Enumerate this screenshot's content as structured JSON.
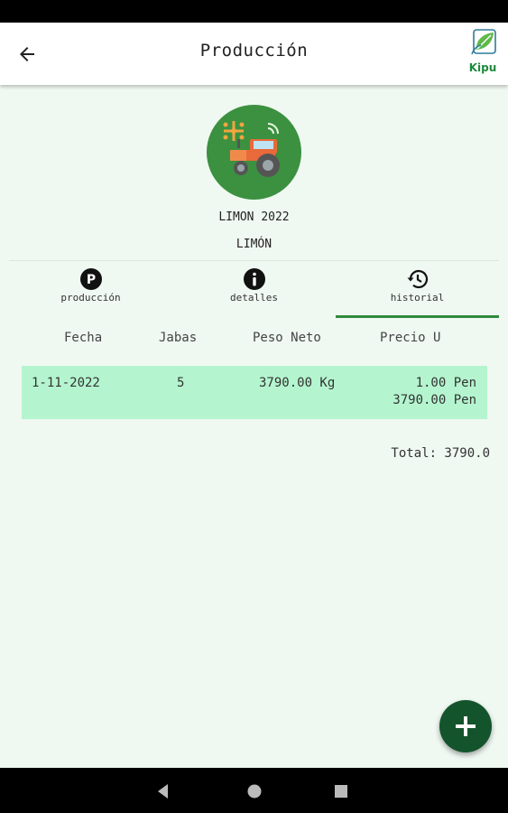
{
  "header": {
    "title": "Producción",
    "logo_text": "Kipu"
  },
  "crop": {
    "name": "LIMON 2022",
    "type": "LIMÓN"
  },
  "tabs": [
    {
      "label": "producción",
      "icon": "p-circle-icon"
    },
    {
      "label": "detalles",
      "icon": "info-circle-icon"
    },
    {
      "label": "historial",
      "icon": "history-icon",
      "selected": true
    }
  ],
  "table": {
    "headers": [
      "Fecha",
      "Jabas",
      "Peso Neto",
      "Precio U"
    ],
    "rows": [
      {
        "fecha": "1-11-2022",
        "jabas": "5",
        "peso_neto": "3790.00 Kg",
        "precio_u": "1.00 Pen",
        "subtotal": "3790.00 Pen"
      }
    ]
  },
  "total": "Total: 3790.0",
  "fab": {
    "icon": "plus-icon"
  },
  "colors": {
    "primary_dark": "#14542c",
    "row_highlight": "#b4f5cf",
    "background": "#f0f8f2",
    "avatar_bg": "#3b9140"
  }
}
